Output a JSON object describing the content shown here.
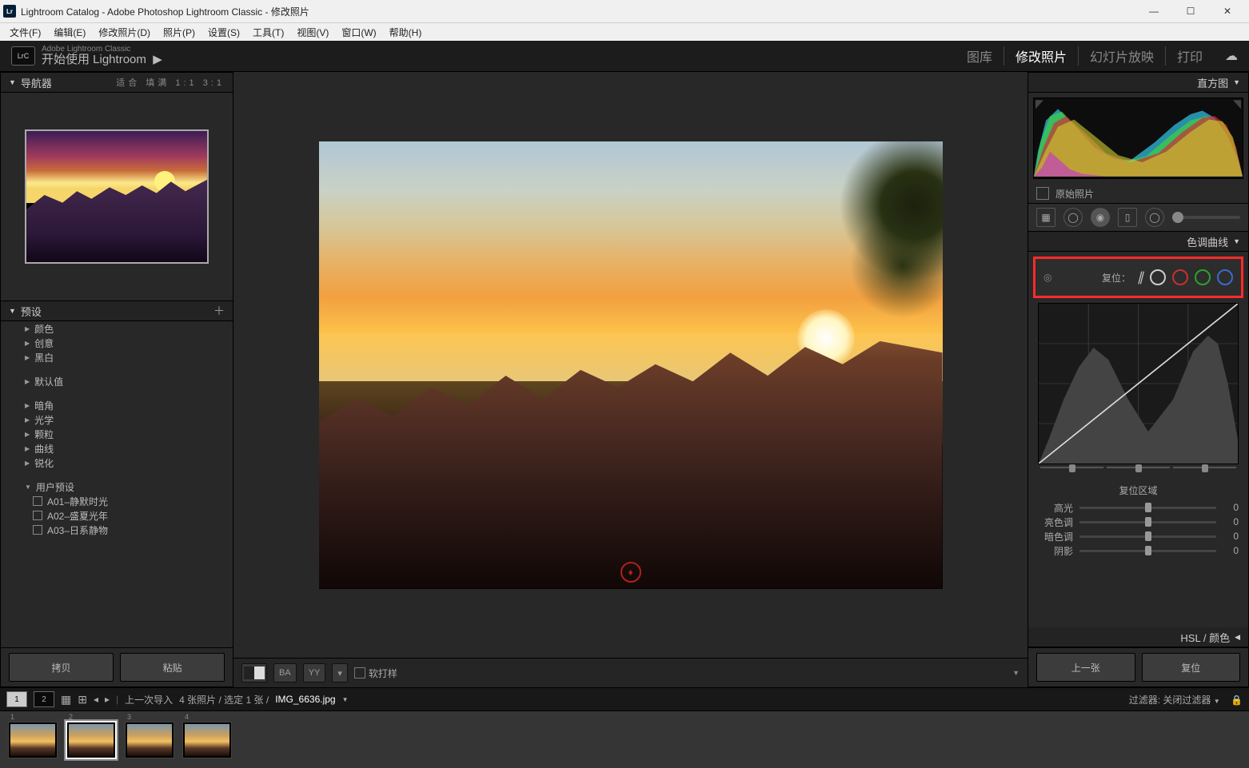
{
  "window": {
    "title": "Lightroom Catalog - Adobe Photoshop Lightroom Classic - 修改照片"
  },
  "menu": [
    "文件(F)",
    "编辑(E)",
    "修改照片(D)",
    "照片(P)",
    "设置(S)",
    "工具(T)",
    "视图(V)",
    "窗口(W)",
    "帮助(H)"
  ],
  "topbar": {
    "logo": "LrC",
    "sub1": "Adobe Lightroom Classic",
    "sub2": "开始使用 Lightroom",
    "modules": [
      {
        "label": "图库",
        "active": false
      },
      {
        "label": "修改照片",
        "active": true
      },
      {
        "label": "幻灯片放映",
        "active": false
      },
      {
        "label": "打印",
        "active": false
      }
    ]
  },
  "navigator": {
    "title": "导航器",
    "zoom": "适合  填满  1:1  3:1"
  },
  "presets": {
    "title": "预设",
    "groups1": [
      "颜色",
      "创意",
      "黑白"
    ],
    "groups2": [
      "默认值"
    ],
    "groups3": [
      "暗角",
      "光学",
      "颗粒",
      "曲线",
      "锐化"
    ],
    "user_title": "用户预设",
    "user_items": [
      "A01–静默时光",
      "A02–盛夏光年",
      "A03–日系静物"
    ]
  },
  "leftButtons": {
    "copy": "拷贝",
    "paste": "粘贴"
  },
  "toolbar": {
    "soft": "软打样",
    "ba": "BA",
    "yy": "YY"
  },
  "histogram": {
    "title": "直方图",
    "original": "原始照片"
  },
  "toneCurve": {
    "title": "色调曲线",
    "reset": "复位：",
    "channels": [
      "parametric",
      "luma",
      "red",
      "green",
      "blue"
    ],
    "region_title": "复位区域",
    "sliders": [
      {
        "name": "高光",
        "value": "0"
      },
      {
        "name": "亮色调",
        "value": "0"
      },
      {
        "name": "暗色调",
        "value": "0"
      },
      {
        "name": "阴影",
        "value": "0"
      }
    ]
  },
  "hsl": {
    "title": "HSL / 颜色"
  },
  "rightButtons": {
    "prev": "上一张",
    "reset": "复位"
  },
  "filmstrip": {
    "pages": [
      "1",
      "2"
    ],
    "breadcrumb_prefix": "上一次导入",
    "breadcrumb_count": "4 张照片 / 选定 1 张 /",
    "breadcrumb_file": "IMG_6636.jpg",
    "filter_label": "过滤器:",
    "filter_value": "关闭过滤器",
    "thumbs": [
      1,
      2,
      3,
      4
    ],
    "selected": 2
  },
  "colors": {
    "highlight_box": "#ff2a2a",
    "chan_red": "#c93030",
    "chan_green": "#2ea02e",
    "chan_blue": "#3a6ad0"
  }
}
